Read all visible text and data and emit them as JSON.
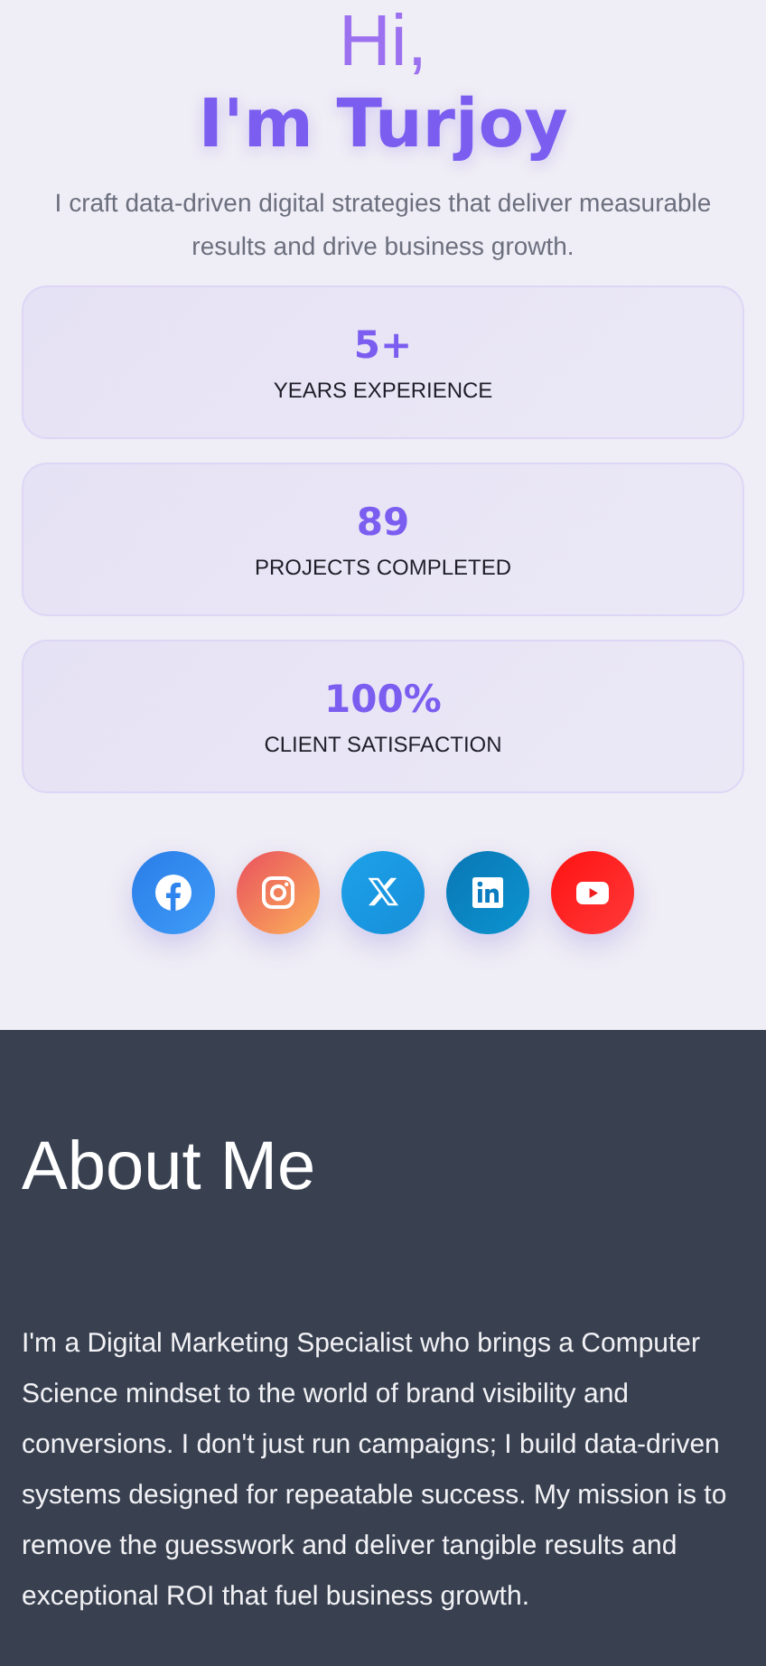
{
  "hero": {
    "greeting": "Hi,",
    "name": "I'm Turjoy",
    "tagline": "I craft data-driven digital strategies that deliver measurable results and drive business growth."
  },
  "stats": [
    {
      "value": "5+",
      "label": "YEARS EXPERIENCE"
    },
    {
      "value": "89",
      "label": "PROJECTS COMPLETED"
    },
    {
      "value": "100%",
      "label": "CLIENT SATISFACTION"
    }
  ],
  "socials": [
    {
      "kind": "facebook"
    },
    {
      "kind": "instagram"
    },
    {
      "kind": "x"
    },
    {
      "kind": "linkedin"
    },
    {
      "kind": "youtube"
    }
  ],
  "about": {
    "title": "About Me",
    "text": "I'm a Digital Marketing Specialist who brings a Computer Science mindset to the world of brand visibility and conversions. I don't just run campaigns; I build data-driven systems designed for repeatable success. My mission is to remove the guesswork and deliver tangible results and exceptional ROI that fuel business growth."
  }
}
